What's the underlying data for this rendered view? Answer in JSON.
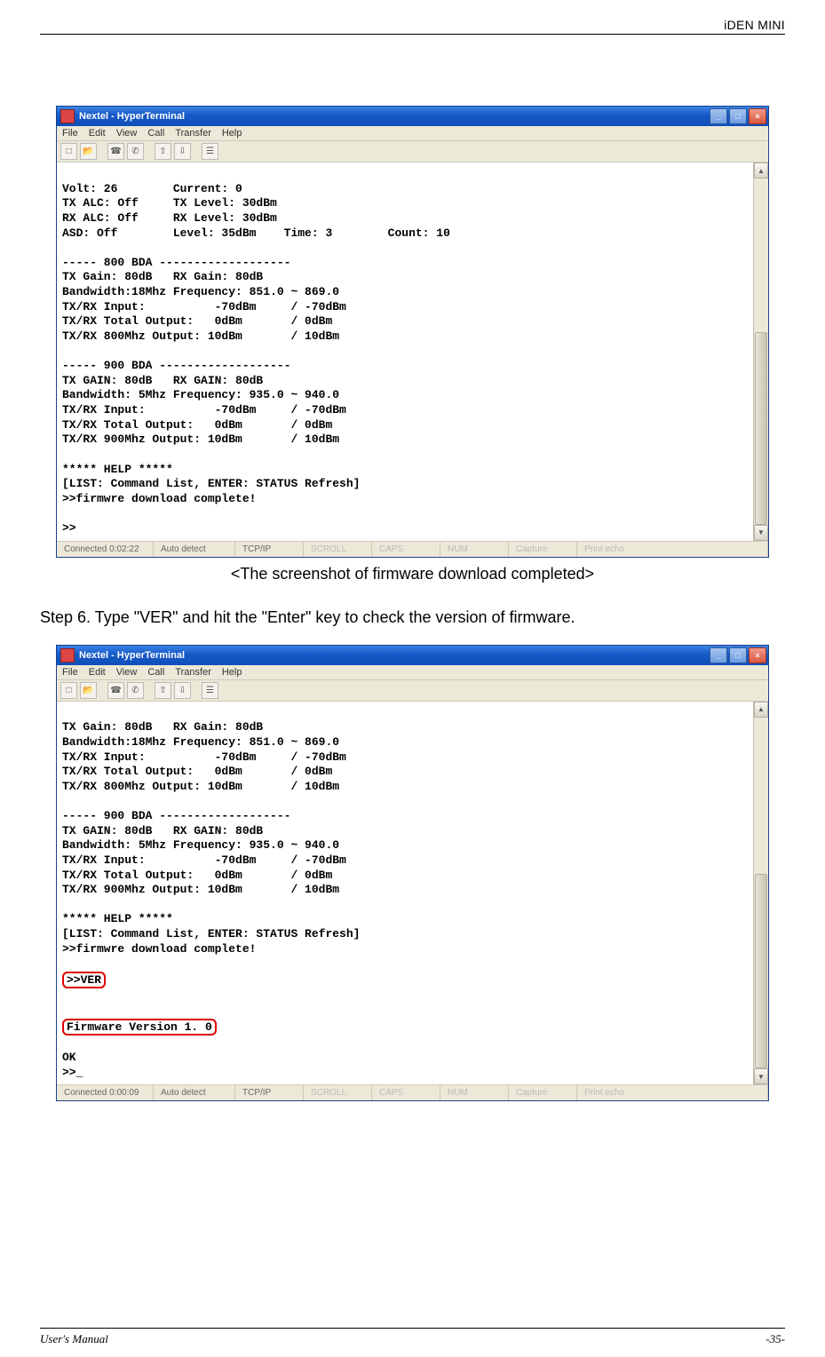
{
  "header": "iDEN MINI",
  "footer": {
    "left": "User's Manual",
    "right": "-35-"
  },
  "caption1": "<The screenshot of firmware download completed>",
  "step6": "Step 6.   Type \"VER\" and hit the \"Enter\" key to check the version of firmware.",
  "window": {
    "title": "Nextel - HyperTerminal",
    "menu": [
      "File",
      "Edit",
      "View",
      "Call",
      "Transfer",
      "Help"
    ]
  },
  "status1": {
    "connected": "Connected 0:02:22",
    "detect": "Auto detect",
    "proto": "TCP/IP",
    "fields": [
      "SCROLL",
      "CAPS",
      "NUM",
      "Capture",
      "Print echo"
    ]
  },
  "status2": {
    "connected": "Connected 0:00:09",
    "detect": "Auto detect",
    "proto": "TCP/IP",
    "fields": [
      "SCROLL",
      "CAPS",
      "NUM",
      "Capture",
      "Print echo"
    ]
  },
  "terminal1": "\nVolt: 26        Current: 0\nTX ALC: Off     TX Level: 30dBm\nRX ALC: Off     RX Level: 30dBm\nASD: Off        Level: 35dBm    Time: 3        Count: 10\n\n----- 800 BDA -------------------\nTX Gain: 80dB   RX Gain: 80dB\nBandwidth:18Mhz Frequency: 851.0 ~ 869.0\nTX/RX Input:          -70dBm     / -70dBm\nTX/RX Total Output:   0dBm       / 0dBm\nTX/RX 800Mhz Output: 10dBm       / 10dBm\n\n----- 900 BDA -------------------\nTX GAIN: 80dB   RX GAIN: 80dB\nBandwidth: 5Mhz Frequency: 935.0 ~ 940.0\nTX/RX Input:          -70dBm     / -70dBm\nTX/RX Total Output:   0dBm       / 0dBm\nTX/RX 900Mhz Output: 10dBm       / 10dBm\n\n***** HELP *****\n[LIST: Command List, ENTER: STATUS Refresh]\n>>firmwre download complete!\n\n>>",
  "terminal2_pre": "\nTX Gain: 80dB   RX Gain: 80dB\nBandwidth:18Mhz Frequency: 851.0 ~ 869.0\nTX/RX Input:          -70dBm     / -70dBm\nTX/RX Total Output:   0dBm       / 0dBm\nTX/RX 800Mhz Output: 10dBm       / 10dBm\n\n----- 900 BDA -------------------\nTX GAIN: 80dB   RX GAIN: 80dB\nBandwidth: 5Mhz Frequency: 935.0 ~ 940.0\nTX/RX Input:          -70dBm     / -70dBm\nTX/RX Total Output:   0dBm       / 0dBm\nTX/RX 900Mhz Output: 10dBm       / 10dBm\n\n***** HELP *****\n[LIST: Command List, ENTER: STATUS Refresh]\n>>firmwre download complete!\n",
  "terminal2_ver": ">>VER",
  "terminal2_blank": "\n\n",
  "terminal2_fw": "Firmware Version 1. 0",
  "terminal2_post": "\nOK\n>>_"
}
